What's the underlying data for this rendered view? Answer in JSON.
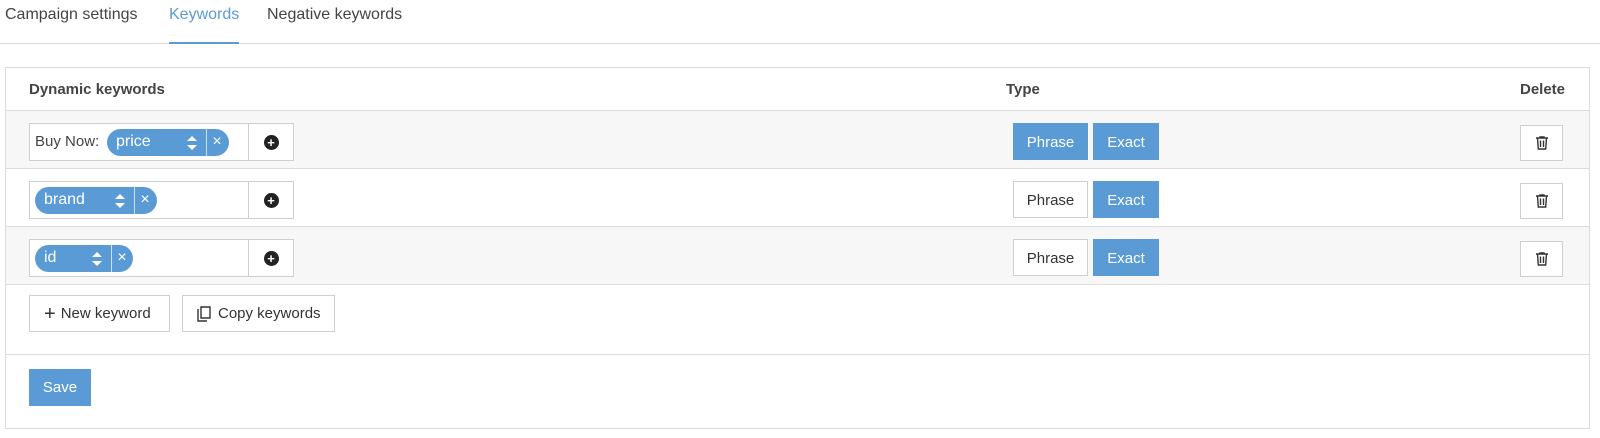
{
  "tabs": [
    {
      "label": "Campaign settings",
      "active": false
    },
    {
      "label": "Keywords",
      "active": true
    },
    {
      "label": "Negative keywords",
      "active": false
    }
  ],
  "table": {
    "headers": {
      "keywords": "Dynamic keywords",
      "type": "Type",
      "delete": "Delete"
    },
    "rows": [
      {
        "prefix": "Buy Now:",
        "token": "price",
        "type_selected": [
          "Phrase",
          "Exact"
        ]
      },
      {
        "prefix": "",
        "token": "brand",
        "type_selected": [
          "Exact"
        ]
      },
      {
        "prefix": "",
        "token": "id",
        "type_selected": [
          "Exact"
        ]
      }
    ],
    "type_options": {
      "phrase": "Phrase",
      "exact": "Exact"
    }
  },
  "actions": {
    "new_keyword": "New keyword",
    "copy_keywords": "Copy keywords"
  },
  "save_label": "Save",
  "colors": {
    "accent": "#5b9bd5",
    "border": "#dcdcdc"
  },
  "icons": {
    "add": "plus-circle-icon",
    "delete": "trash-icon",
    "sort": "sort-arrows-icon",
    "remove": "close-icon",
    "new": "plus-icon",
    "copy": "copy-icon"
  }
}
